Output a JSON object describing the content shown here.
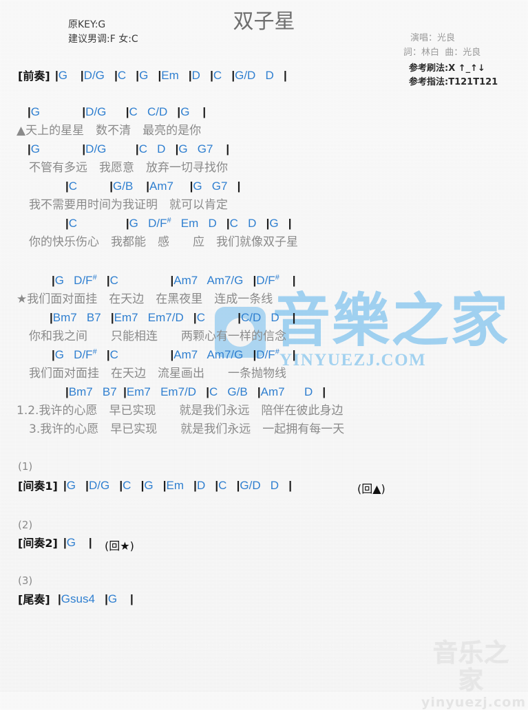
{
  "header": {
    "title": "双子星",
    "original_key_label": "原KEY:G",
    "suggested_key_label": "建议男调:F 女:C",
    "singer_label": "演唱：光良",
    "writer_label": "詞：林白  曲：光良",
    "strum_label": "参考刷法:X ↑_↑↓",
    "fingerstyle_label": "参考指法:T121T121"
  },
  "watermark": {
    "center_cn": "音樂之家",
    "center_en": "YINYUEZJ.COM",
    "corner_cn": "音乐之家",
    "corner_en": "yinyuezj.com"
  },
  "sections": {
    "prelude_label": "[前奏]",
    "interlude1_label": "[间奏1]",
    "interlude2_label": "[间奏2]",
    "outro_label": "[尾奏]",
    "num1": "(1)",
    "num2": "(2)",
    "num3": "(3)",
    "return_verse": "(回▲)",
    "return_chorus": "(回★)"
  },
  "lines": {
    "prelude_chords": "|G    |D/G    |C    |G    |Em    |D    |C    |G/D    D    |",
    "v1_chords_1": "|G               |D/G        |C    C/D    |G    |",
    "v1_lyric_1": "▲天上的星星　数不清　最亮的是你",
    "v1_chords_2": "|G               |D/G              |C    D    |G    G7    |",
    "v1_lyric_2": "不管有多远　我愿意　放弃一切寻找你",
    "v1_chords_3": "|C              |G/B      |Am7        |G    G7    |",
    "v1_lyric_3": "我不需要用时间为我证明　就可以肯定",
    "v1_chords_4": "|C                  |G    D/F#    Em    D    |C    D    |G    |",
    "v1_lyric_4": "你的快乐伤心　我都能　感　　应　我们就像双子星",
    "c1_chords_1": "|G    D/F#    |C                |Am7    Am7/G    |D/F#    |",
    "c1_lyric_1": "★我们面对面挂　在天边　在黑夜里　连成一条线",
    "c1_chords_2": "|Bm7    B7    |Em7    Em7/D    |C            |C/D    D    |",
    "c1_lyric_2": "你和我之间　　只能相连　　两颗心有一样的信念",
    "c2_chords_1": "|G    D/F#    |C                |Am7    Am7/G    |D/F#    |",
    "c2_lyric_1": "我们面对面挂　在天边　流星画出　　一条抛物线",
    "c2_chords_2": "|Bm7    B7    |Em7    Em7/D    |C    G/B    |Am7        D    |",
    "c2_lyric_2": "1.2.我许的心愿　早已实现　　就是我们永远　陪伴在彼此身边",
    "c2_lyric_3": "3.我许的心愿　早已实现　　就是我们永远　一起拥有每一天",
    "interlude1_chords": "|G    |D/G    |C    |G    |Em    |D    |C    |G/D    D    |",
    "interlude2_chords": "|G    |",
    "outro_chords": "|Gsus4    |G    |"
  },
  "colors": {
    "chord": "#2f7fd0",
    "lyric": "#8a8a8a",
    "bar": "#1a1a1a",
    "title": "#6f6f6f",
    "watermark_blue": "#7fc2ee"
  }
}
